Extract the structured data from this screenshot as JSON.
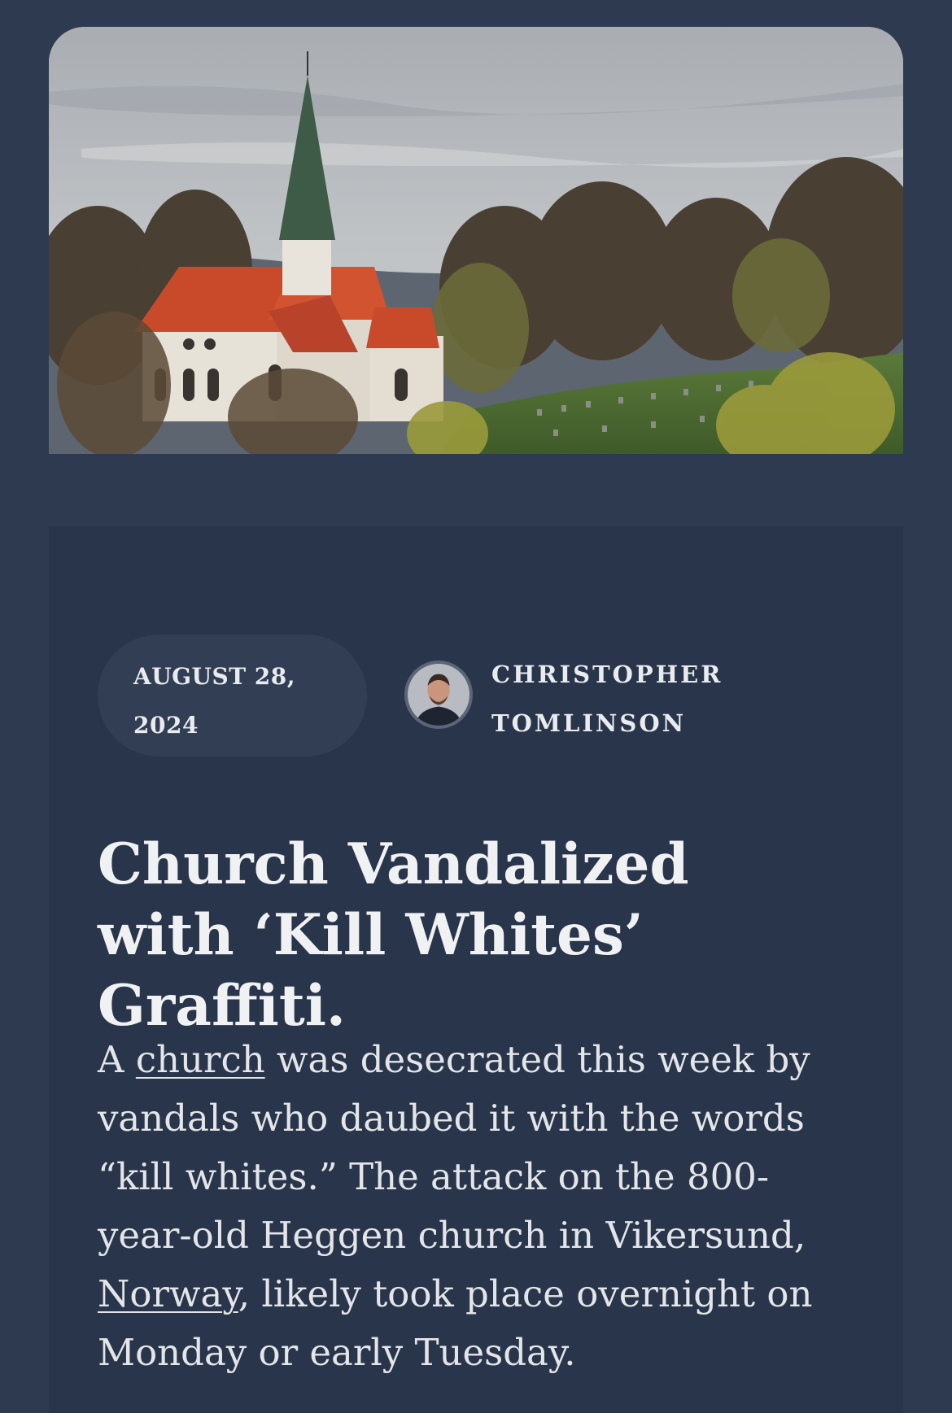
{
  "hero_image": {
    "alt_subject": "church-with-cemetery-photo"
  },
  "article": {
    "date": "AUGUST 28, 2024",
    "author": {
      "first": "CHRISTOPHER",
      "last": "TOMLINSON"
    },
    "headline": "Church Vandalized with ‘Kill Whites’ Graffiti.",
    "body": {
      "p1_start": "A ",
      "link1": "church",
      "p1_mid": " was desecrated this week by vandals who daubed it with the words “kill whites.” The attack on the 800-year-old Heggen church in Vikersund, ",
      "link2": "Norway",
      "p1_end": ", likely took place overnight on Monday or early Tuesday."
    }
  },
  "colors": {
    "background": "#2e3a4f",
    "card": "#28354a",
    "pill": "#313e53",
    "text": "#eef0f2"
  }
}
